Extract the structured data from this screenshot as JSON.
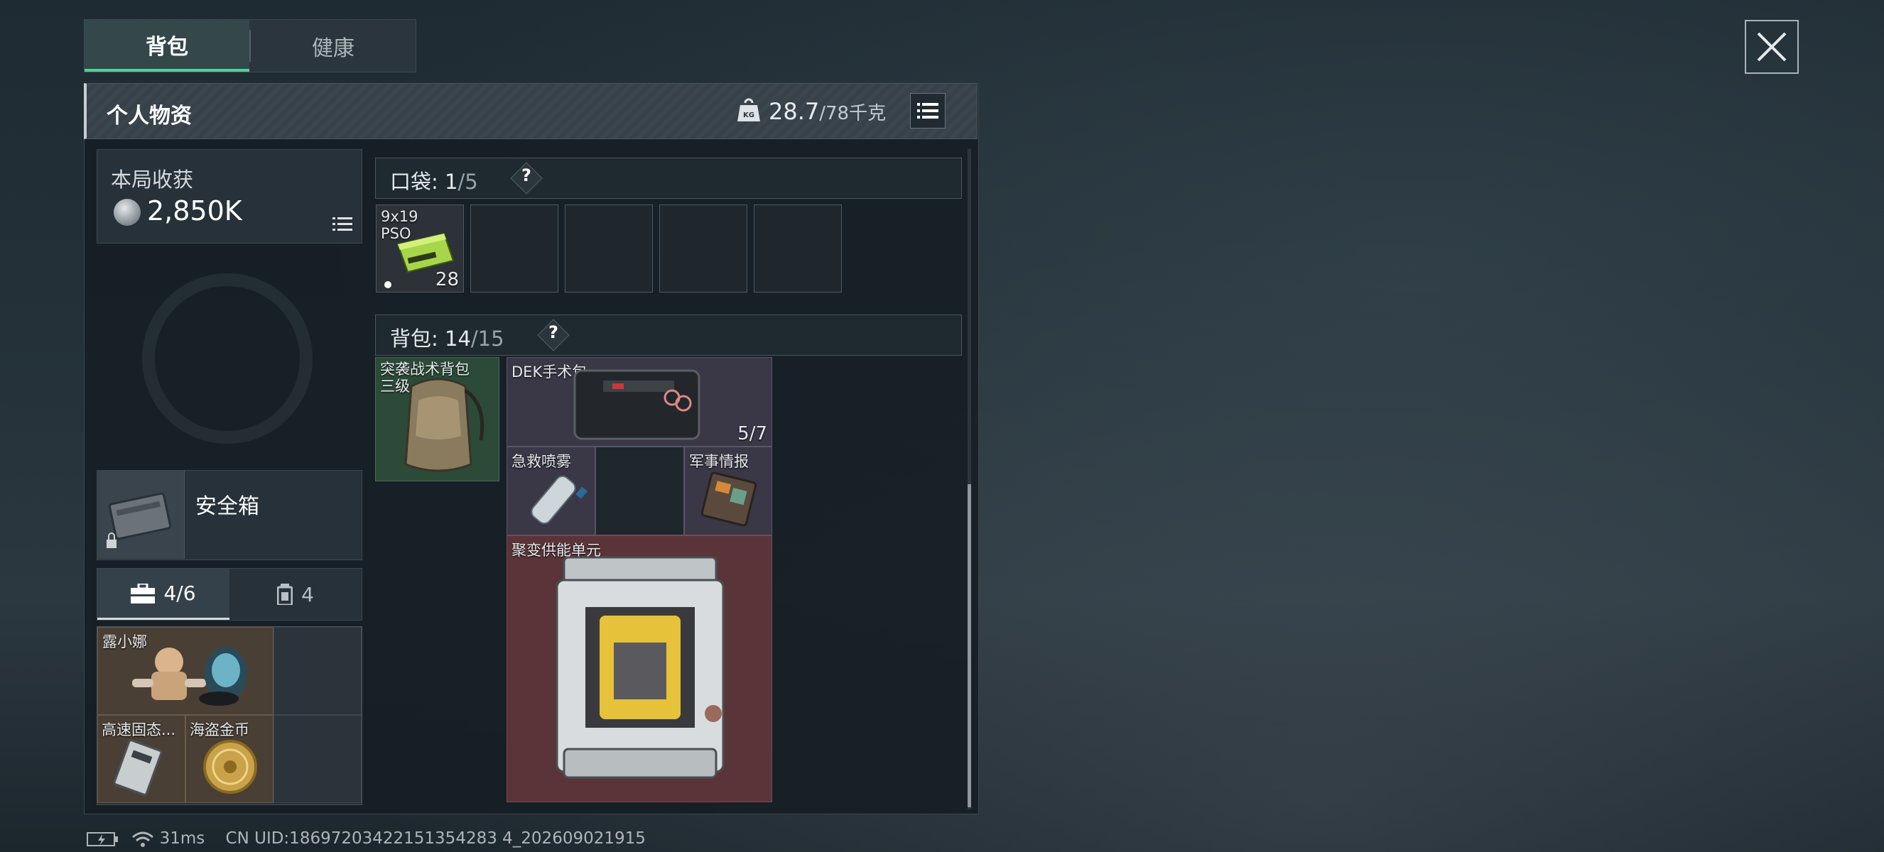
{
  "tabs": [
    {
      "label": "背包",
      "active": true
    },
    {
      "label": "健康",
      "active": false
    }
  ],
  "header": {
    "title": "个人物资",
    "weight_current": "28.7",
    "weight_max": "/78千克"
  },
  "earnings": {
    "label": "本局收获",
    "value": "2,850K"
  },
  "safe_box": {
    "label": "安全箱"
  },
  "sub_tabs": [
    {
      "label": "4/6",
      "icon": "briefcase-icon",
      "active": true
    },
    {
      "label": "4",
      "icon": "canister-icon",
      "active": false
    }
  ],
  "safe_items": [
    {
      "label": "露小娜"
    },
    {
      "label": "高速固态..."
    },
    {
      "label": "海盗金币"
    }
  ],
  "pockets": {
    "label": "口袋:",
    "count": "1",
    "capacity": "/5",
    "help": "?",
    "items": [
      {
        "label_line1": "9x19",
        "label_line2": "PSO",
        "quantity": "28"
      }
    ]
  },
  "backpack": {
    "label": "背包:",
    "count": "14",
    "capacity": "/15",
    "help": "?",
    "bag_label_line1": "突袭战术背包",
    "bag_label_line2": "三级",
    "items": [
      {
        "label": "DEK手术包",
        "quantity": "5/7"
      },
      {
        "label": "急救喷雾"
      },
      {
        "label": "军事情报"
      },
      {
        "label": "聚变供能单元"
      }
    ]
  },
  "status_bar": {
    "ping": "31ms",
    "uid": "CN UID:18697203422151354283 4_202609021915"
  },
  "colors": {
    "accent_green": "#4ed39a",
    "rare_purple": "#3a3746",
    "legendary_red": "#5a3438",
    "uncommon_green": "#2c4a38",
    "safe_brown": "#4a3f35"
  }
}
